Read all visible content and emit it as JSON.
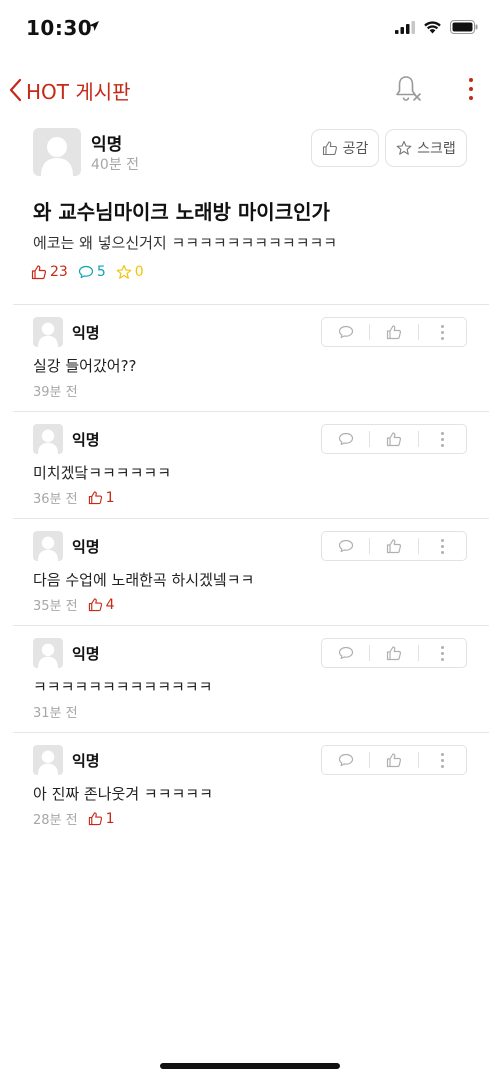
{
  "status_bar": {
    "time": "10:30"
  },
  "nav": {
    "back_label": "HOT 게시판"
  },
  "post": {
    "author": "익명",
    "time": "40분 전",
    "like_button": "공감",
    "scrap_button": "스크랩",
    "title": "와 교수님마이크 노래방 마이크인가",
    "body": "에코는 왜 넣으신거지 ㅋㅋㅋㅋㅋㅋㅋㅋㅋㅋㅋㅋ",
    "likes": "23",
    "comments": "5",
    "scraps": "0"
  },
  "comments": [
    {
      "author": "익명",
      "text": "실강 들어갔어??",
      "time": "39분 전",
      "likes": ""
    },
    {
      "author": "익명",
      "text": "미치겠닼ㅋㅋㅋㅋㅋㅋ",
      "time": "36분 전",
      "likes": "1"
    },
    {
      "author": "익명",
      "text": "다음 수업에 노래한곡 하시겠넼ㅋㅋ",
      "time": "35분 전",
      "likes": "4"
    },
    {
      "author": "익명",
      "text": "ㅋㅋㅋㅋㅋㅋㅋㅋㅋㅋㅋㅋㅋ",
      "time": "31분 전",
      "likes": ""
    },
    {
      "author": "익명",
      "text": "아 진짜 존나웃겨 ㅋㅋㅋㅋㅋ",
      "time": "28분 전",
      "likes": "1"
    }
  ],
  "colors": {
    "accent": "#c62917",
    "comment_stat": "#0ca5b0",
    "scrap_stat": "#f1c40f",
    "muted": "#a7a7a7"
  },
  "icons": [
    "location-arrow-icon",
    "signal-icon",
    "wifi-icon",
    "battery-icon",
    "back-chevron-icon",
    "bell-off-icon",
    "more-vertical-icon",
    "thumbs-up-icon",
    "star-icon",
    "speech-bubble-icon",
    "avatar-icon"
  ]
}
